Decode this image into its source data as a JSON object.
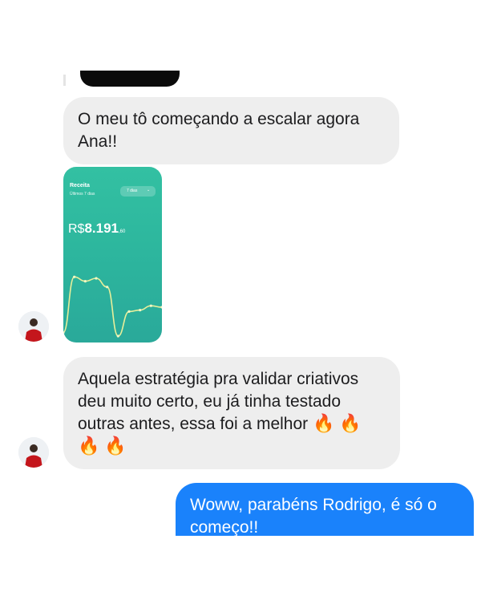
{
  "messages": [
    {
      "text": "O meu tô começando a escalar agora Ana!!"
    },
    {
      "text": "Aquela estratégia pra validar criativos deu muito certo, eu já tinha testado outras antes, essa foi a melhor",
      "emoji": [
        "🔥",
        "🔥",
        "🔥",
        "🔥"
      ]
    },
    {
      "text": "Woww, parabéns Rodrigo, é só o começo!!"
    }
  ],
  "attachment": {
    "title": "Receita",
    "subtitle": "Últimos 7 dias",
    "period": "7 dias",
    "currency": "R$",
    "amount": "8.191",
    "cents": ",60",
    "chart_data": {
      "type": "line",
      "x": [
        0,
        1,
        2,
        3,
        4,
        5,
        6,
        7,
        8,
        9
      ],
      "values": [
        0.15,
        0.92,
        0.86,
        0.9,
        0.78,
        0.1,
        0.44,
        0.46,
        0.52,
        0.5
      ]
    }
  },
  "colors": {
    "incoming_bubble": "#eeeeee",
    "outgoing_bubble": "#1a82fb",
    "card_green": "#2db79e"
  }
}
